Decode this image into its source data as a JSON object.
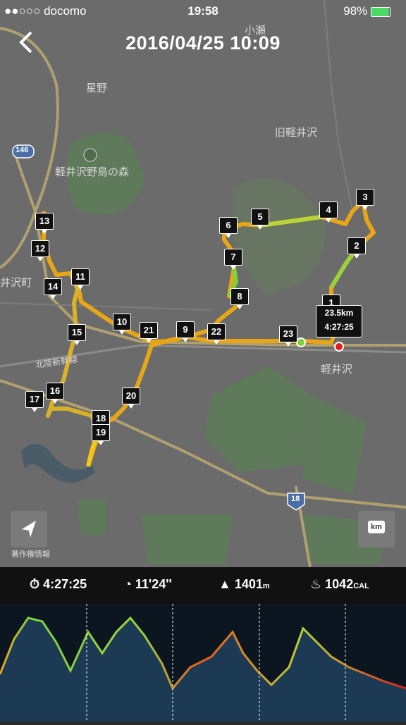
{
  "status_bar": {
    "carrier": "●●○○○ docomo",
    "time": "19:58",
    "battery": "98%"
  },
  "header": {
    "title": "2016/04/25  10:09"
  },
  "map_labels": {
    "kose": "小瀬",
    "hoshino": "星野",
    "kyu_karuizawa": "旧軽井沢",
    "route_146": "146",
    "wild_bird_forest": "軽井沢野鳥の森",
    "ikarui_town": "井沢町",
    "shinkansen": "北陸新幹線",
    "karuizawa": "軽井沢",
    "route_18": "18",
    "attribution": "著作権情報"
  },
  "markers": [
    "1",
    "2",
    "3",
    "4",
    "5",
    "6",
    "7",
    "8",
    "9",
    "10",
    "11",
    "12",
    "13",
    "14",
    "15",
    "16",
    "17",
    "18",
    "19",
    "20",
    "21",
    "22",
    "23"
  ],
  "tooltip": {
    "distance": "23.5km",
    "duration": "4:27:25"
  },
  "controls": {
    "km_label": "km"
  },
  "stats": {
    "duration": "4:27:25",
    "pace": "11'24''",
    "elevation": "1401",
    "elevation_unit": "m",
    "calories": "1042",
    "calories_unit": "CAL"
  },
  "colors": {
    "route_start": "#7fd13b",
    "route_mid": "#f5c518",
    "route_end": "#e85a1a",
    "chart_fill": "#1d3a55"
  }
}
